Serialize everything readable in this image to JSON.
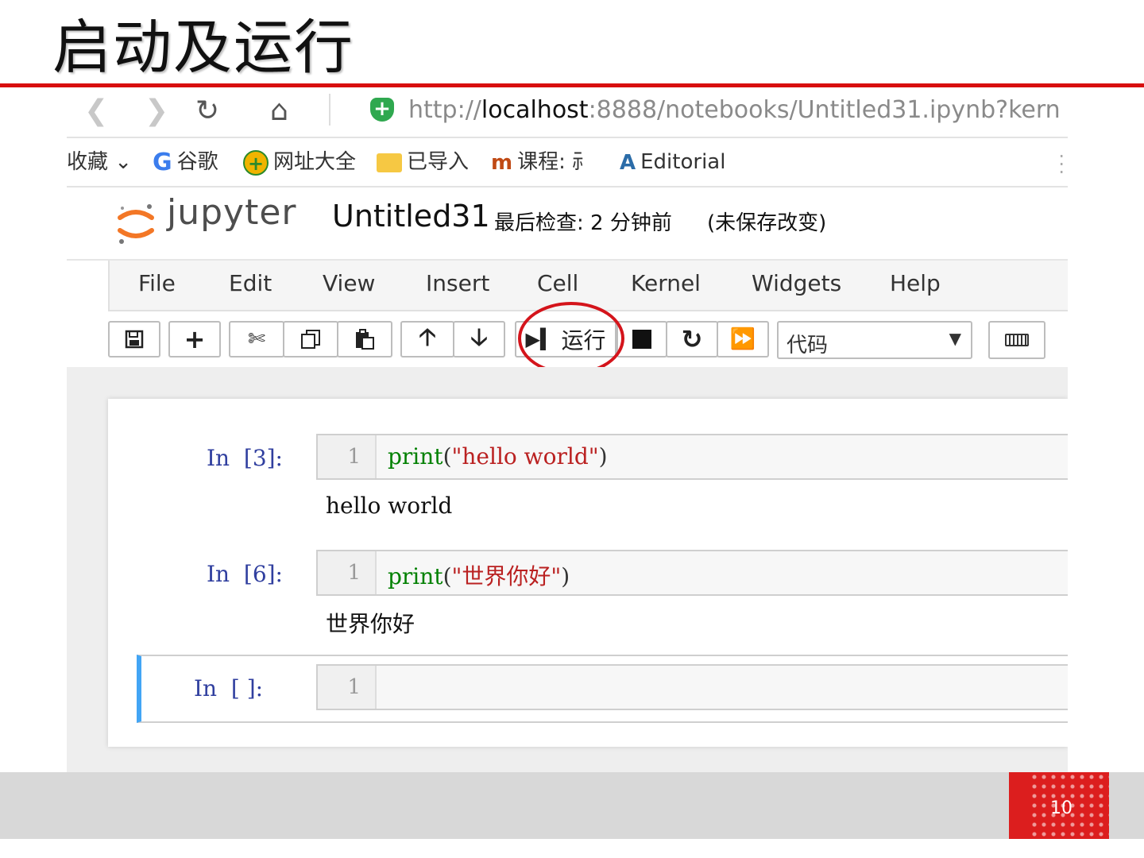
{
  "slide": {
    "title": "启动及运行",
    "page_number": "10"
  },
  "browser": {
    "url_prefix": "http://",
    "url_host": "localhost",
    "url_rest": ":8888/notebooks/Untitled31.ipynb?kern",
    "bookmarks": [
      "收藏 ⌄",
      "谷歌",
      "网址大全",
      "已导入",
      "课程:  ⺬",
      "Editorial"
    ]
  },
  "notebook": {
    "logo_text": "jupyter",
    "name": "Untitled31",
    "checkpoint": "最后检查: 2 分钟前",
    "status": "(未保存改变)",
    "menu": [
      "File",
      "Edit",
      "View",
      "Insert",
      "Cell",
      "Kernel",
      "Widgets",
      "Help"
    ],
    "toolbar": {
      "run_label": "运行",
      "cell_type": "代码"
    },
    "cells": [
      {
        "prompt": "In  [3]:",
        "line": "1",
        "code_fn": "print",
        "code_open": "(",
        "code_str": "\"hello world\"",
        "code_close": ")",
        "output": "hello world"
      },
      {
        "prompt": "In  [6]:",
        "line": "1",
        "code_fn": "print",
        "code_open": "(",
        "code_str": "\"世界你好\"",
        "code_close": ")",
        "output": "世界你好"
      },
      {
        "prompt": "In  [ ]:",
        "line": "1"
      }
    ]
  },
  "colors": {
    "accent_red": "#d80f0f",
    "selected_cell": "#42a5f5",
    "prompt_blue": "#303f9f"
  }
}
